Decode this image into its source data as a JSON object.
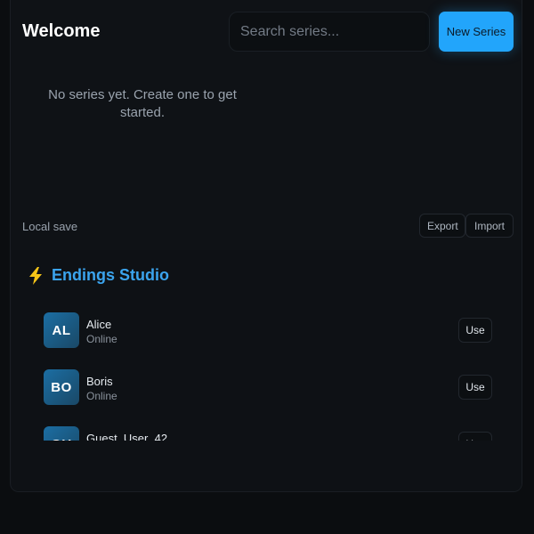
{
  "header": {
    "title": "Welcome",
    "search_placeholder": "Search series...",
    "new_series_label": "New Series"
  },
  "empty_state": {
    "message": "No series yet. Create one to get started."
  },
  "local_save": {
    "label": "Local save",
    "export_label": "Export",
    "import_label": "Import"
  },
  "studio": {
    "icon": "lightning-bolt-icon",
    "name": "Endings Studio",
    "users": [
      {
        "initials": "AL",
        "name": "Alice",
        "status": "Online",
        "action": "Use"
      },
      {
        "initials": "BO",
        "name": "Boris",
        "status": "Online",
        "action": "Use"
      },
      {
        "initials": "GU",
        "name": "Guest_User_42",
        "status": "",
        "action": "Use"
      }
    ]
  },
  "colors": {
    "accent": "#22a5fb",
    "studio_title": "#3ba4ee",
    "bolt": "#f5c518"
  }
}
